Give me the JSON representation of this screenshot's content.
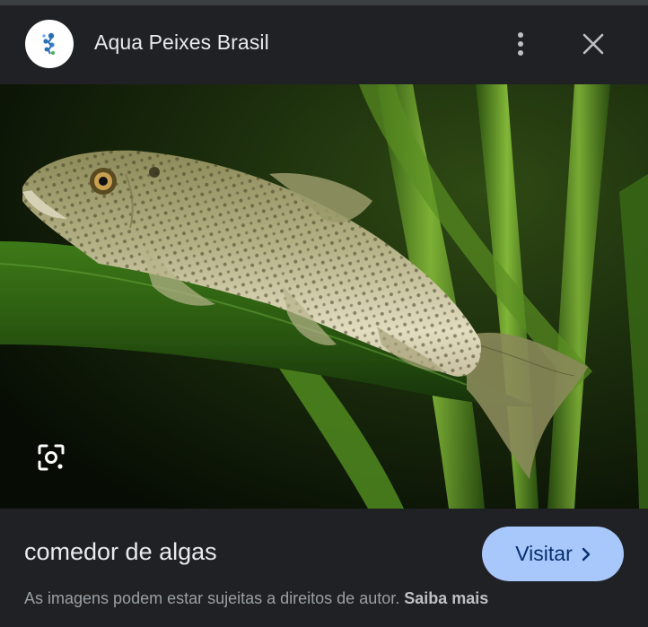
{
  "header": {
    "site_name": "Aqua Peixes Brasil",
    "site_icon": "aquarium-logo-icon",
    "more_icon": "more-vertical-icon",
    "close_icon": "close-icon"
  },
  "image": {
    "subject": "fish-on-leaf-photo",
    "lens_icon": "google-lens-icon"
  },
  "footer": {
    "caption": "comedor de algas",
    "visit_label": "Visitar",
    "visit_icon": "chevron-right-icon",
    "copyright_text": "As imagens podem estar sujeitas a direitos de autor.",
    "learn_more_label": "Saiba mais"
  },
  "colors": {
    "background": "#202124",
    "accent_button": "#a8c7fa",
    "text_primary": "#e8eaed",
    "text_secondary": "#9aa0a6"
  }
}
